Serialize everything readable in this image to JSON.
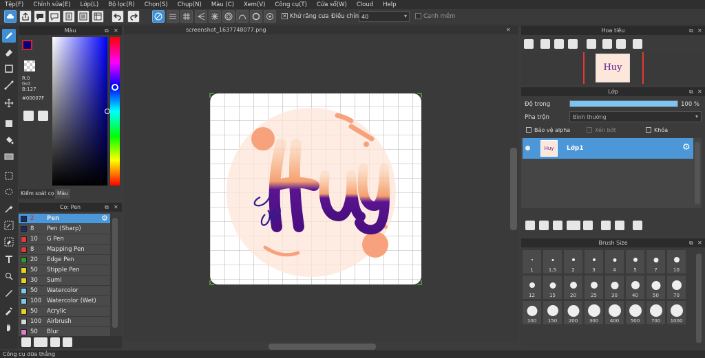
{
  "menu": [
    "Tệp(F)",
    "Chỉnh sửa(E)",
    "Lớp(L)",
    "Bộ lọc(R)",
    "Chọn(S)",
    "Chụp(N)",
    "Màu (C)",
    "Xem(V)",
    "Công cụ(T)",
    "Cửa sổ(W)",
    "Cloud",
    "Help"
  ],
  "toolbar": {
    "antialias_label": "Khử răng cưa",
    "correction_label": "Điều chỉnh",
    "correction_value": "40",
    "soft_edge_label": "Cạnh mềm"
  },
  "color_panel": {
    "title": "Màu",
    "r": "R:0",
    "g": "G:0",
    "b": "B:127",
    "hex": "#00007F",
    "tab_brush_control": "Kiểm soát cọ",
    "tab_color": "Màu",
    "fg_color": "#00007F"
  },
  "brush_panel": {
    "title": "Cọ: Pen",
    "items": [
      {
        "size": "2",
        "name": "Pen",
        "color": "#1e2a6a"
      },
      {
        "size": "8",
        "name": "Pen (Sharp)",
        "color": "#1e2a6a"
      },
      {
        "size": "10",
        "name": "G Pen",
        "color": "#e53935"
      },
      {
        "size": "8",
        "name": "Mapping Pen",
        "color": "#e53935"
      },
      {
        "size": "20",
        "name": "Edge Pen",
        "color": "#2e9b2e"
      },
      {
        "size": "50",
        "name": "Stipple Pen",
        "color": "#e8d21c"
      },
      {
        "size": "30",
        "name": "Sumi",
        "color": "#e8d21c"
      },
      {
        "size": "50",
        "name": "Watercolor",
        "color": "#7ec8f0"
      },
      {
        "size": "100",
        "name": "Watercolor (Wet)",
        "color": "#7ec8f0"
      },
      {
        "size": "50",
        "name": "Acrylic",
        "color": "#e8d21c"
      },
      {
        "size": "100",
        "name": "Airbrush",
        "color": "#d9d9d9"
      },
      {
        "size": "50",
        "name": "Blur",
        "color": "#e27ad0"
      }
    ]
  },
  "document": {
    "filename": "screenshot_1637748077.png",
    "artwork_text": "Huy"
  },
  "navigator": {
    "title": "Hoa tiêu"
  },
  "layer_panel": {
    "title": "Lớp",
    "opacity_label": "Độ trong",
    "opacity_value": "100 %",
    "opacity": 1.0,
    "blend_label": "Pha trộn",
    "blend_value": "Bình thường",
    "protect_alpha": "Bảo vệ alpha",
    "clipping": "Xén bớt",
    "lock": "Khóa",
    "layer_name": "Lớp1"
  },
  "brush_size_panel": {
    "title": "Brush Size",
    "sizes": [
      "1",
      "1.5",
      "2",
      "3",
      "4",
      "5",
      "7",
      "10",
      "12",
      "15",
      "20",
      "25",
      "30",
      "40",
      "50",
      "70",
      "100",
      "150",
      "200",
      "300",
      "400",
      "500",
      "700",
      "1000"
    ]
  },
  "status": "Công cụ dữa thẳng"
}
